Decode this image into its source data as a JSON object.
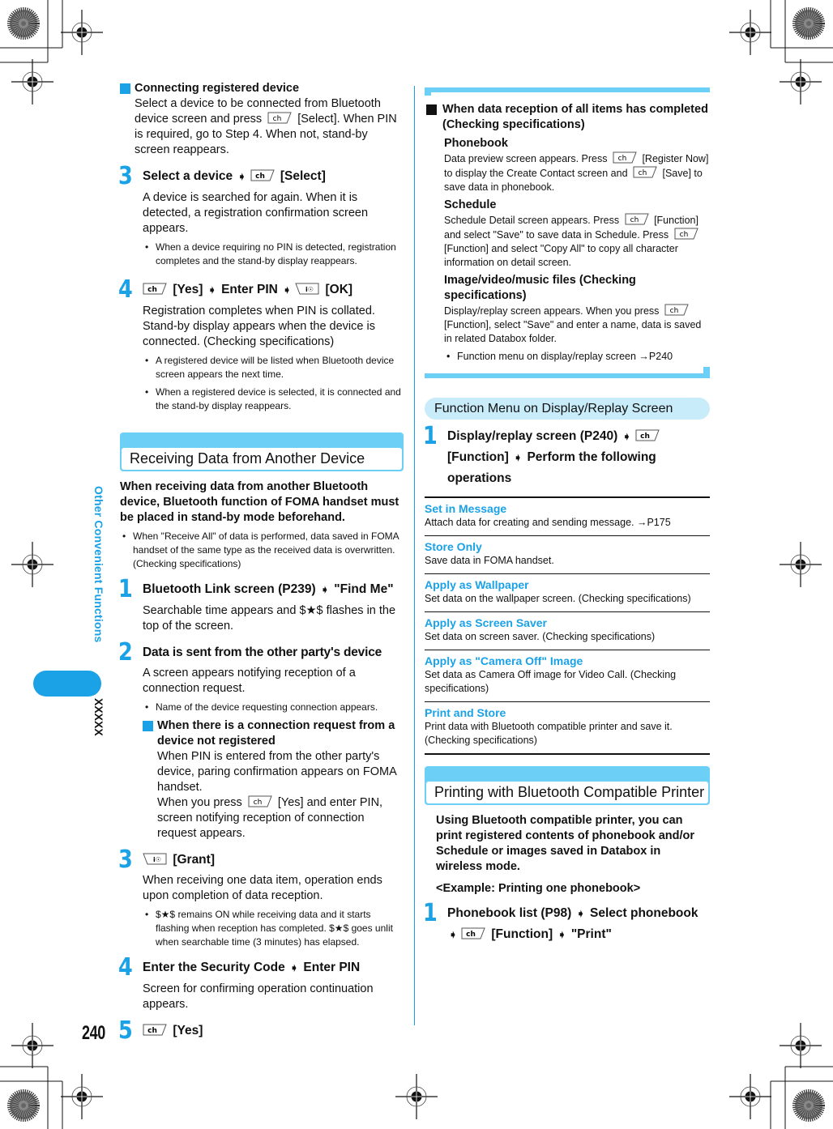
{
  "page": {
    "number": "240",
    "side_tab": "Other Convenient Functions",
    "side_code": "XXXXX"
  },
  "left": {
    "connecting": {
      "heading": "Connecting registered device",
      "body_before_key": "Select a device to be connected from Bluetooth device screen and press",
      "body_after_key": "[Select]. When PIN is required, go to Step 4. When not, stand-by screen reappears."
    },
    "steps_a": [
      {
        "num": "3",
        "title_parts": [
          "Select a device",
          "[Select]"
        ],
        "body": "A device is searched for again. When it is detected, a registration confirmation screen appears.",
        "bullets": [
          "When a device requiring no PIN is detected, registration completes and the stand-by display reappears."
        ]
      },
      {
        "num": "4",
        "title_parts": [
          "[Yes]",
          "Enter PIN",
          "[OK]"
        ],
        "body": "Registration completes when PIN is collated. Stand-by display appears when the device is connected. (Checking specifications)",
        "bullets": [
          "A registered device will be listed when Bluetooth device screen appears the next time.",
          "When a registered device is selected, it is connected and the stand-by display reappears."
        ]
      }
    ],
    "receiving": {
      "header": "Receiving Data from Another Device",
      "intro": "When receiving data from another Bluetooth device, Bluetooth function of FOMA handset must be placed in stand-by mode beforehand.",
      "intro_bullet": "When \"Receive All\" of data is performed, data saved in FOMA handset of the same type as the received data is overwritten. (Checking specifications)",
      "step1": {
        "num": "1",
        "title_a": "Bluetooth Link screen (P239)",
        "title_b": "\"Find Me\"",
        "body": "Searchable time appears and $★$ flashes in the top of the screen."
      },
      "step2": {
        "num": "2",
        "title": "Data is sent from the other party's device",
        "body": "A screen appears notifying reception of a connection request.",
        "bullet": "Name of the device requesting connection appears.",
        "sub_heading": "When there is a connection request from a device not registered",
        "sub_body1": "When PIN is entered from the other party's device, paring confirmation appears on FOMA handset.",
        "sub_body2_before": "When you press",
        "sub_body2_after": "[Yes] and enter PIN, screen notifying reception of connection request appears."
      },
      "step3": {
        "num": "3",
        "title": "[Grant]",
        "body": "When receiving one data item, operation ends upon completion of data reception.",
        "bullet": "$★$ remains ON while receiving data and it starts flashing when reception has completed. $★$ goes unlit when searchable time (3 minutes) has elapsed."
      },
      "step4": {
        "num": "4",
        "title_a": "Enter the Security Code",
        "title_b": "Enter PIN",
        "body": "Screen for confirming operation continuation appears."
      },
      "step5": {
        "num": "5",
        "title": "[Yes]"
      }
    }
  },
  "right": {
    "note": {
      "heading": "When data reception of all items has completed (Checking specifications)",
      "phonebook_title": "Phonebook",
      "phonebook_a": "Data preview screen appears. Press",
      "phonebook_b": "[Register Now] to display the Create Contact screen and",
      "phonebook_c": "[Save] to save data in phonebook.",
      "schedule_title": "Schedule",
      "schedule_a": "Schedule Detail screen appears. Press",
      "schedule_b": "[Function] and select \"Save\" to save data in Schedule. Press",
      "schedule_c": "[Function] and select \"Copy All\" to copy all character information on detail screen.",
      "media_title": "Image/video/music files (Checking specifications)",
      "media_a": "Display/replay screen appears. When you press",
      "media_b": "[Function], select \"Save\" and enter a name, data is saved in related Databox folder.",
      "media_bullet": "Function menu on display/replay screen →P240"
    },
    "function_menu": {
      "header": "Function Menu on Display/Replay Screen",
      "step_num": "1",
      "step_a": "Display/replay screen (P240)",
      "step_b": "[Function]",
      "step_c": "Perform the following operations",
      "items": [
        {
          "label": "Set in Message",
          "desc": "Attach data for creating and sending message. →P175"
        },
        {
          "label": "Store Only",
          "desc": "Save data in FOMA handset."
        },
        {
          "label": "Apply as Wallpaper",
          "desc": "Set data on the wallpaper screen. (Checking specifications)"
        },
        {
          "label": "Apply as Screen Saver",
          "desc": "Set data on screen saver. (Checking specifications)"
        },
        {
          "label": "Apply as \"Camera Off\" Image",
          "desc": "Set data as Camera Off image for Video Call. (Checking specifications)"
        },
        {
          "label": "Print and Store",
          "desc": "Print data with Bluetooth compatible printer and save it. (Checking specifications)"
        }
      ]
    },
    "printing": {
      "header": "Printing with Bluetooth Compatible Printer",
      "intro": "Using Bluetooth compatible printer, you can print registered contents of phonebook and/or Schedule or images saved in Databox in wireless mode.",
      "example": "<Example: Printing one phonebook>",
      "step_num": "1",
      "step_a": "Phonebook list (P98)",
      "step_b": "Select phonebook",
      "step_c": "[Function]",
      "step_d": "\"Print\""
    }
  },
  "icons": {
    "menu_key": "menu-key-icon",
    "ok_key": "i-mode-ok-key-icon",
    "arrow": "arrow-right-icon"
  },
  "colors": {
    "accent": "#1aa1e6",
    "header_band": "#6ccff6",
    "header_pill": "#c9ecfa"
  }
}
